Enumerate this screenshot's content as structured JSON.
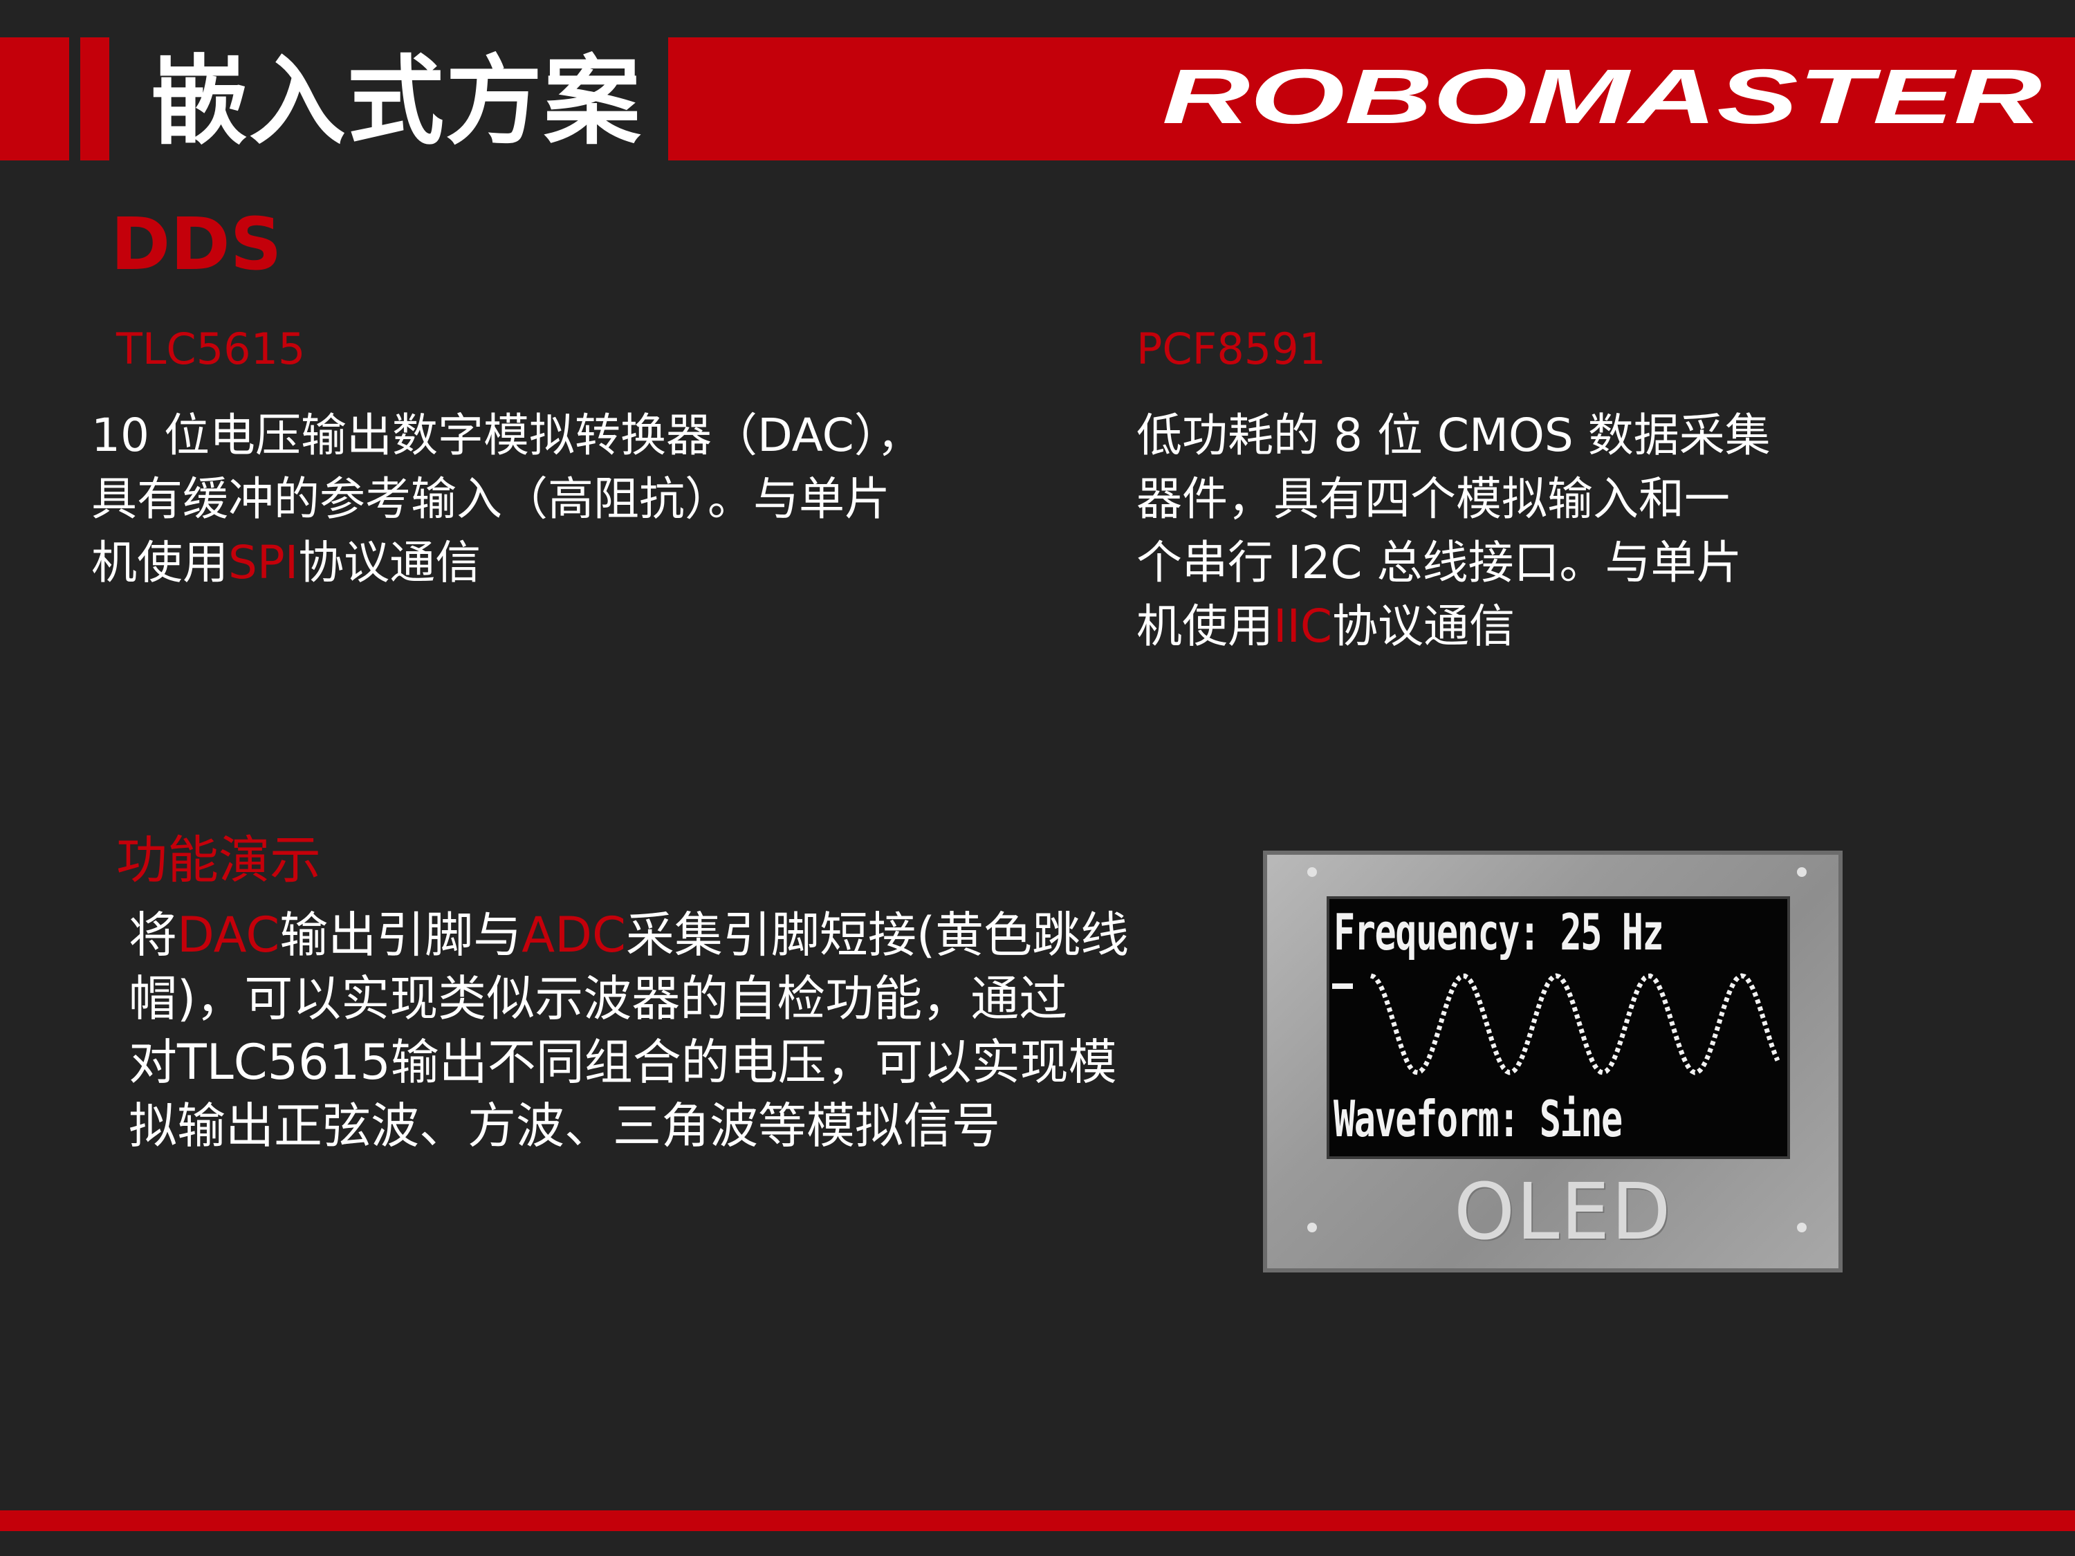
{
  "colors": {
    "accent": "#c4000a",
    "background": "#232323",
    "text": "#ffffff"
  },
  "header": {
    "title": "嵌入式方案",
    "logo_text": "ROBOMASTER"
  },
  "section": {
    "title": "DDS"
  },
  "tlc": {
    "name": "TLC5615",
    "lines": [
      [
        "10 位电压输出数字模拟转换器（DAC），"
      ],
      [
        "具有缓冲的参考输入（高阻抗）。与单片"
      ],
      [
        "机使用",
        "SPI",
        "协议通信"
      ]
    ]
  },
  "pcf": {
    "name": "PCF8591",
    "lines": [
      [
        "低功耗的 8 位 CMOS 数据采集"
      ],
      [
        "器件，具有四个模拟输入和一"
      ],
      [
        "个串行 I2C 总线接口。与单片"
      ],
      [
        "机使用",
        "IIC",
        "协议通信"
      ]
    ]
  },
  "demo": {
    "title": "功能演示",
    "lines": [
      [
        "将",
        "DAC",
        "输出引脚与",
        "ADC",
        "采集引脚短接(黄色跳线"
      ],
      [
        "帽)，可以实现类似示波器的自检功能，通过"
      ],
      [
        "对TLC5615输出不同组合的电压，可以实现模"
      ],
      [
        "拟输出正弦波、方波、三角波等模拟信号"
      ]
    ]
  },
  "oled": {
    "frequency_text": "Frequency: 25 Hz",
    "waveform_text": "Waveform: Sine",
    "module_label": "OLED"
  }
}
